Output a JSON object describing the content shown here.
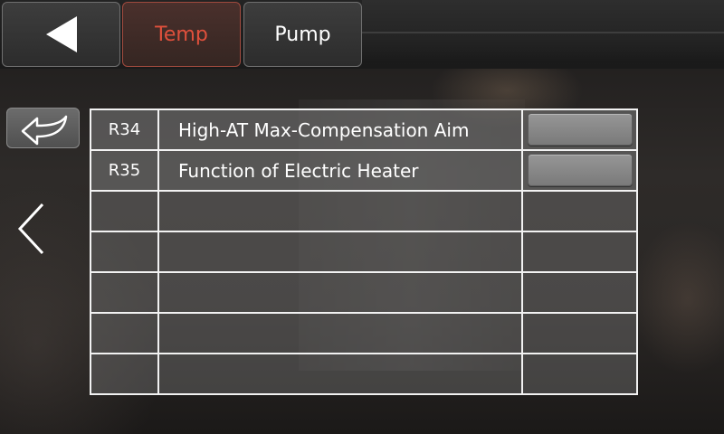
{
  "tabs": {
    "back_icon": "back-triangle-icon",
    "temp_label": "Temp",
    "pump_label": "Pump",
    "active_color": "#e0503c"
  },
  "controls": {
    "return_icon": "return-arrow-icon",
    "prev_page_icon": "chevron-left-icon"
  },
  "table": {
    "rows": [
      {
        "code": "R34",
        "name": "High-AT Max-Compensation Aim",
        "value": ""
      },
      {
        "code": "R35",
        "name": "Function of Electric Heater",
        "value": ""
      },
      {
        "code": "",
        "name": "",
        "value": ""
      },
      {
        "code": "",
        "name": "",
        "value": ""
      },
      {
        "code": "",
        "name": "",
        "value": ""
      },
      {
        "code": "",
        "name": "",
        "value": ""
      },
      {
        "code": "",
        "name": "",
        "value": ""
      }
    ]
  }
}
